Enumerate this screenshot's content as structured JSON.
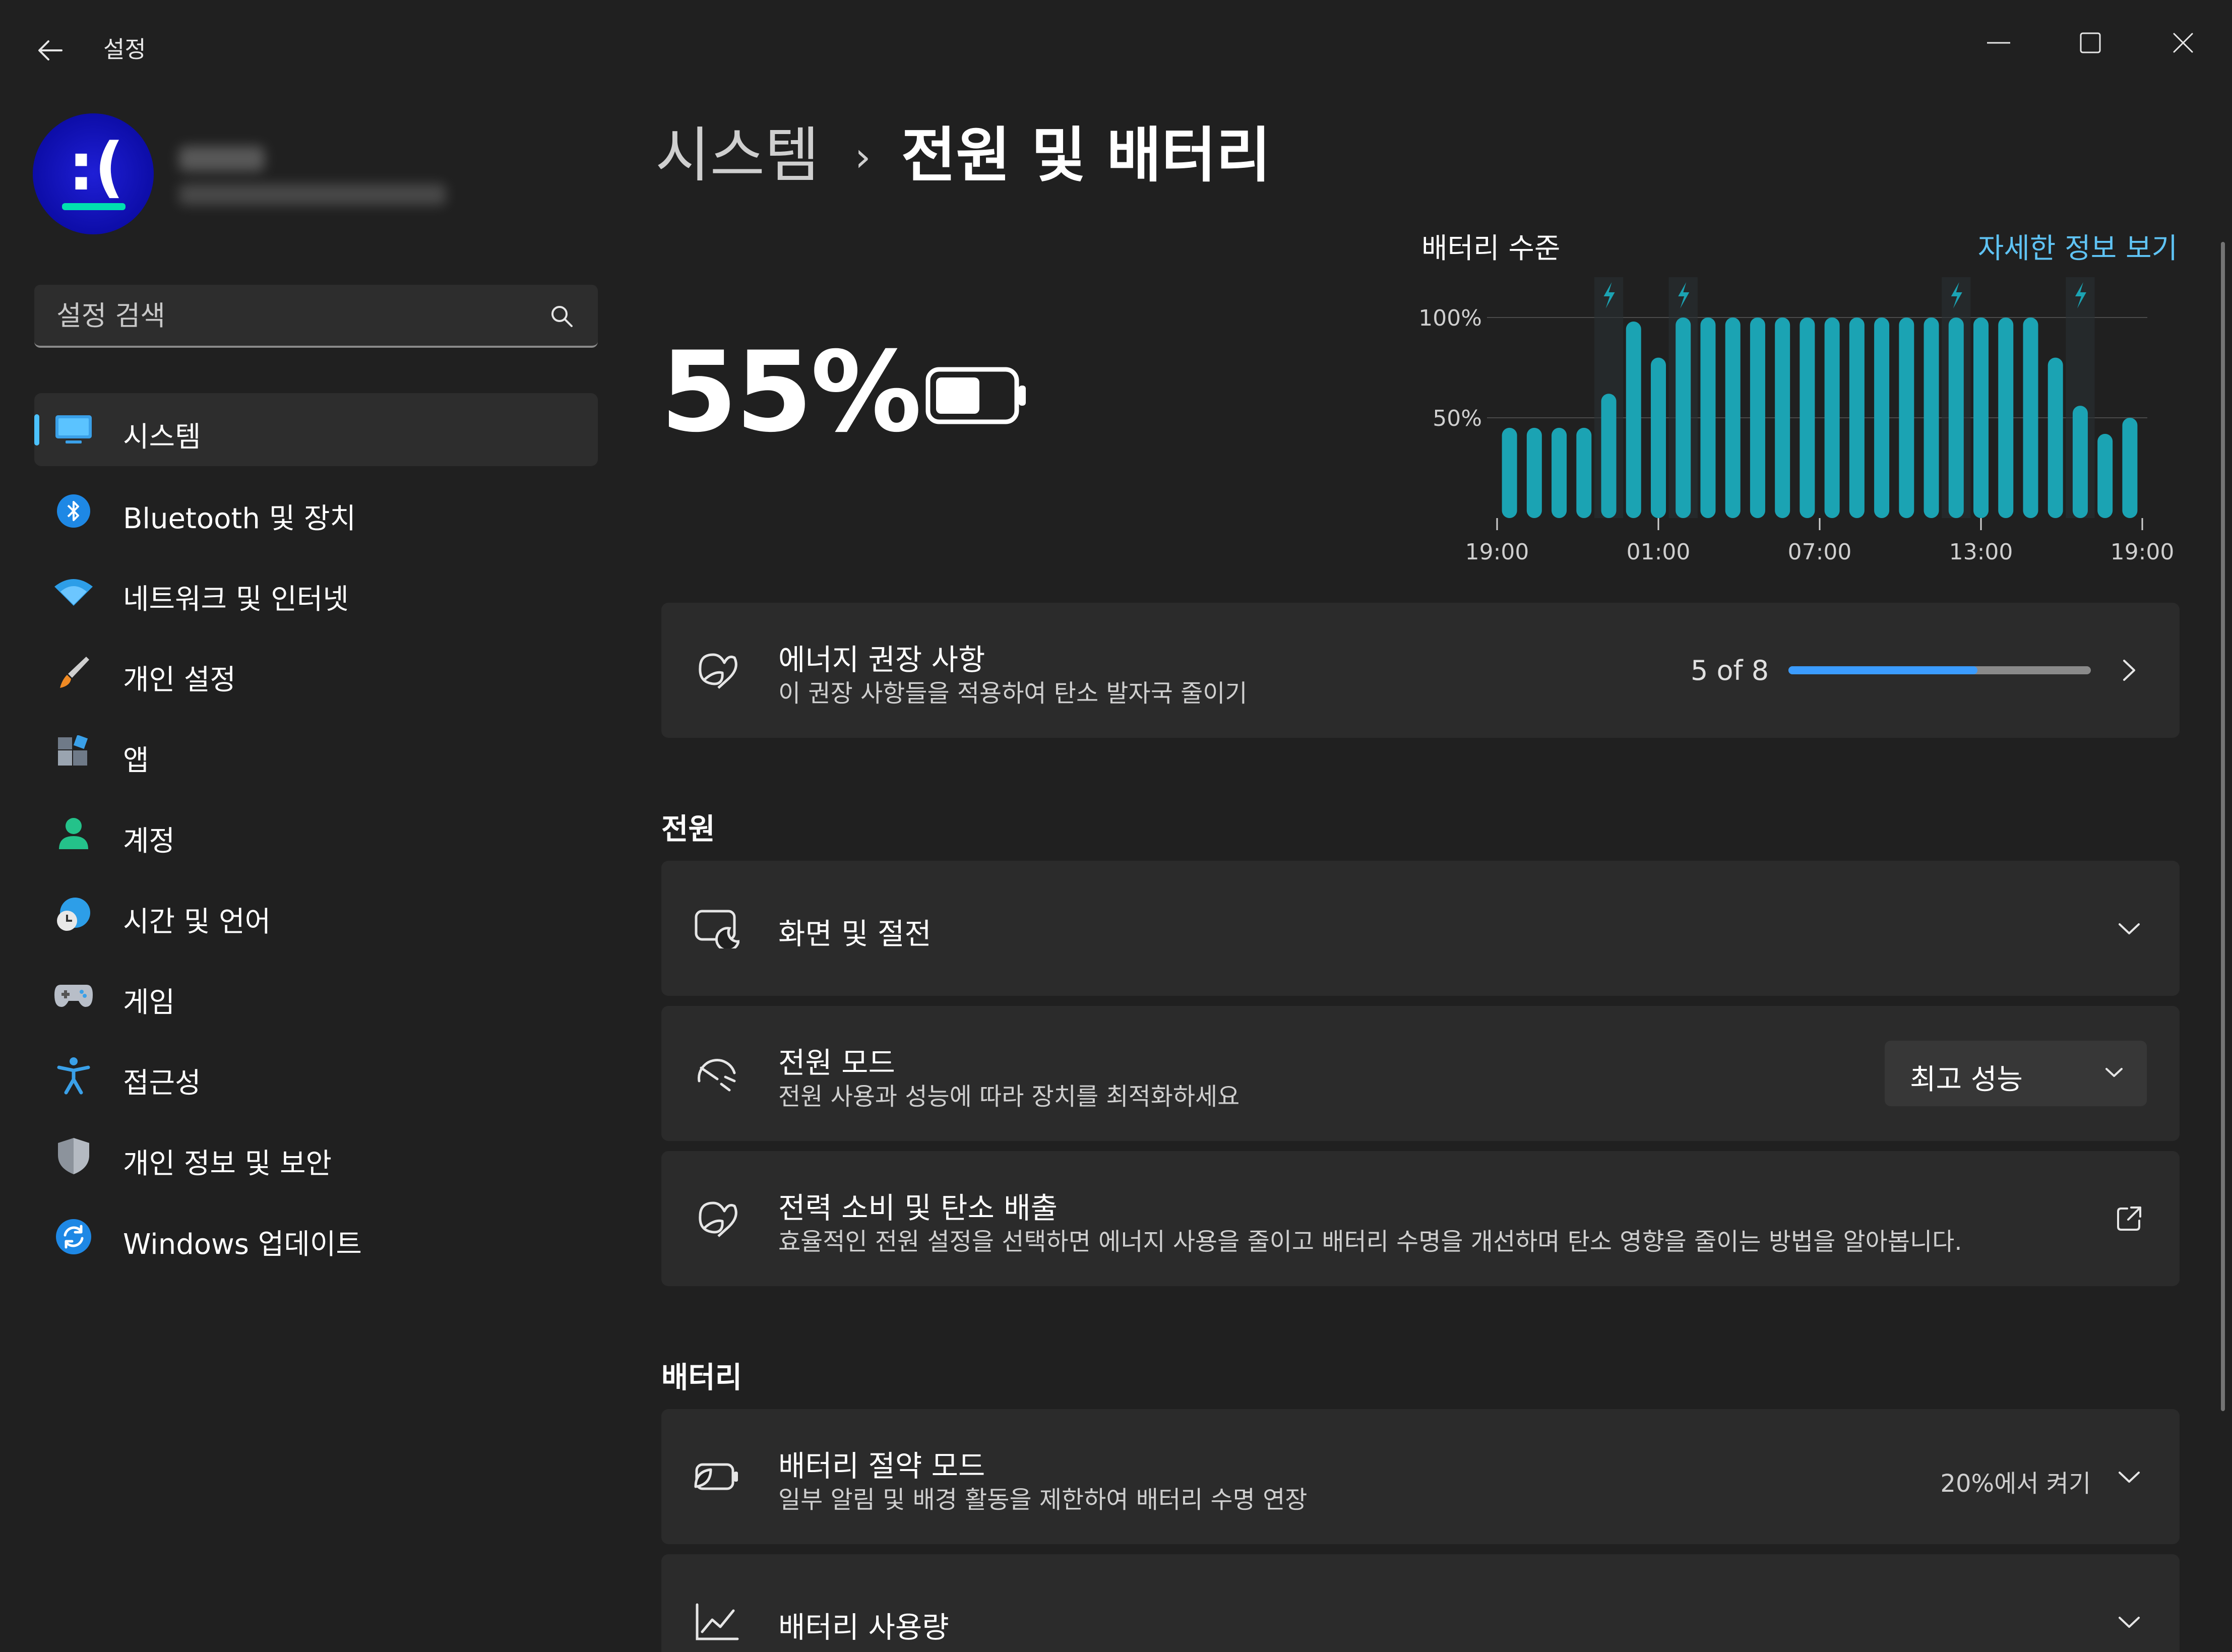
{
  "window": {
    "app_title": "설정",
    "back_icon": "back-arrow-icon",
    "controls": [
      "minimize-icon",
      "maximize-icon",
      "close-icon"
    ]
  },
  "sidebar": {
    "search_placeholder": "설정 검색",
    "items": [
      {
        "label": "시스템",
        "icon": "system-monitor-icon",
        "active": true
      },
      {
        "label": "Bluetooth 및 장치",
        "icon": "bluetooth-icon"
      },
      {
        "label": "네트워크 및 인터넷",
        "icon": "wifi-icon"
      },
      {
        "label": "개인 설정",
        "icon": "brush-icon"
      },
      {
        "label": "앱",
        "icon": "apps-icon"
      },
      {
        "label": "계정",
        "icon": "account-icon"
      },
      {
        "label": "시간 및 언어",
        "icon": "time-language-icon"
      },
      {
        "label": "게임",
        "icon": "gamepad-icon"
      },
      {
        "label": "접근성",
        "icon": "accessibility-icon"
      },
      {
        "label": "개인 정보 및 보안",
        "icon": "shield-icon"
      },
      {
        "label": "Windows 업데이트",
        "icon": "windows-update-icon"
      }
    ]
  },
  "main": {
    "breadcrumb": {
      "parent": "시스템",
      "separator": "›",
      "current": "전원 및 배터리"
    },
    "battery_percent": "55%",
    "battery_level": 0.55,
    "chart": {
      "title": "배터리 수준",
      "link": "자세한 정보 보기"
    },
    "recommendations": {
      "title": "에너지 권장 사항",
      "subtitle": "이 권장 사항들을 적용하여 탄소 발자국 줄이기",
      "progress_text": "5 of 8",
      "progress": 0.625
    },
    "power_section": "전원",
    "screen_sleep": {
      "title": "화면 및 절전"
    },
    "power_mode": {
      "title": "전원 모드",
      "subtitle": "전원 사용과 성능에 따라 장치를 최적화하세요",
      "value": "최고 성능"
    },
    "power_consumption": {
      "title": "전력 소비 및 탄소 배출",
      "subtitle": "효율적인 전원 설정을 선택하면 에너지 사용을 줄이고 배터리 수명을 개선하며 탄소 영향을 줄이는 방법을 알아봅니다."
    },
    "battery_section": "배터리",
    "battery_saver": {
      "title": "배터리 절약 모드",
      "subtitle": "일부 알림 및 배경 활동을 제한하여 배터리 수명 연장",
      "value": "20%에서 켜기"
    },
    "battery_usage": {
      "title": "배터리 사용량"
    }
  },
  "chart_data": {
    "type": "bar",
    "title": "배터리 수준",
    "xlabel": "",
    "ylabel": "",
    "ylim": [
      0,
      100
    ],
    "y_ticks": [
      "100%",
      "50%"
    ],
    "x_ticks": [
      "19:00",
      "01:00",
      "07:00",
      "13:00",
      "19:00"
    ],
    "grid": true,
    "values": [
      45,
      45,
      45,
      45,
      62,
      98,
      80,
      100,
      100,
      100,
      100,
      100,
      100,
      100,
      100,
      100,
      100,
      100,
      100,
      100,
      100,
      100,
      80,
      56,
      42,
      50
    ],
    "charging_markers": [
      4,
      7,
      18,
      23
    ],
    "bar_color": "#1ba3b3",
    "marker_color": "#1ba3b3"
  }
}
